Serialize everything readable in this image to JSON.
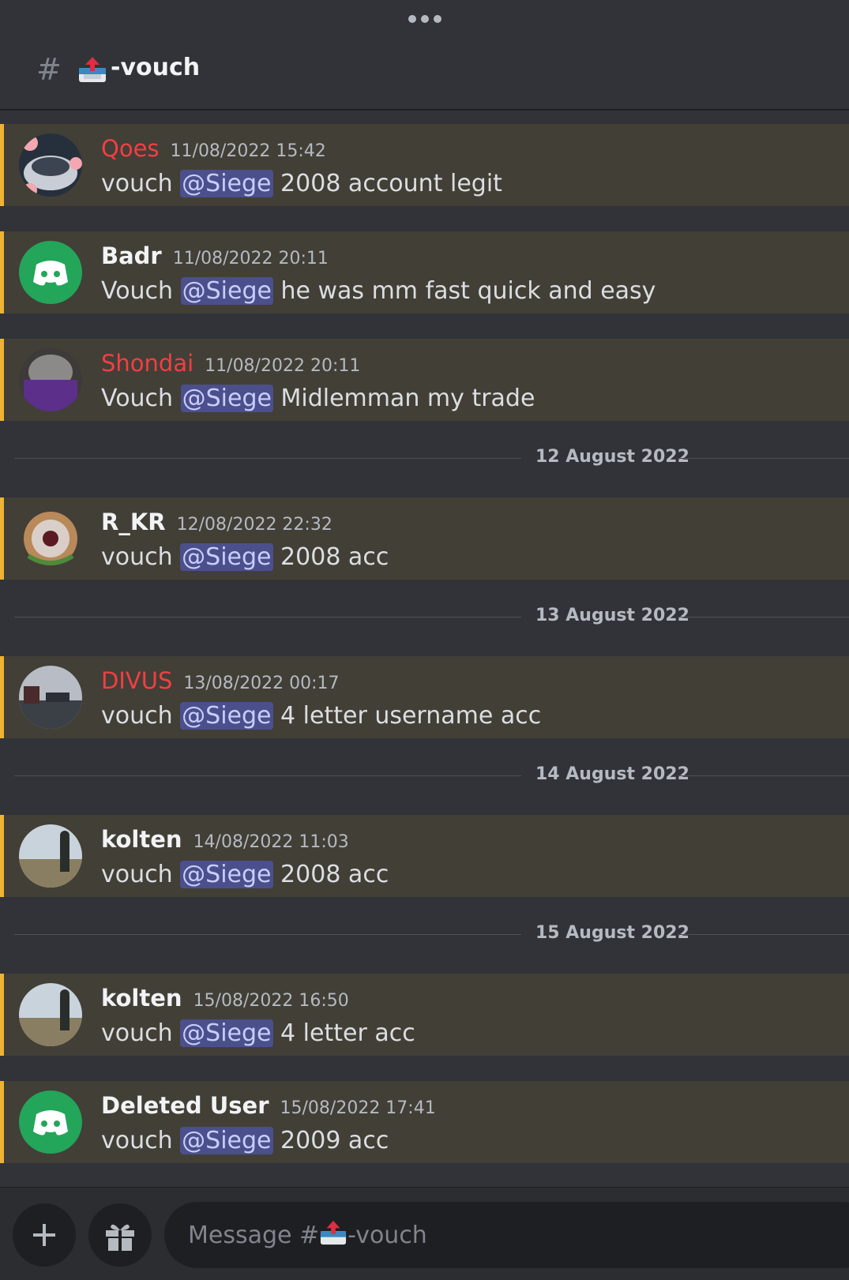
{
  "channel": {
    "hash": "#",
    "name": "-vouch",
    "icon": "outbox-tray-icon"
  },
  "messages": [
    {
      "author": "Qoes",
      "timestamp": "11/08/2022 15:42",
      "pre": "vouch ",
      "mention": "@Siege",
      "post": " 2008 account legit"
    },
    {
      "author": "Badr",
      "timestamp": "11/08/2022 20:11",
      "pre": "Vouch ",
      "mention": "@Siege",
      "post": " he was mm fast quick and easy"
    },
    {
      "author": "Shondai",
      "timestamp": "11/08/2022 20:11",
      "pre": "Vouch ",
      "mention": "@Siege",
      "post": " Midlemman my trade"
    },
    {
      "author": "R_KR",
      "timestamp": "12/08/2022 22:32",
      "pre": "vouch ",
      "mention": "@Siege",
      "post": " 2008 acc"
    },
    {
      "author": "DIVUS",
      "timestamp": "13/08/2022 00:17",
      "pre": "vouch ",
      "mention": "@Siege",
      "post": " 4 letter username acc"
    },
    {
      "author": "kolten",
      "timestamp": "14/08/2022 11:03",
      "pre": "vouch ",
      "mention": "@Siege",
      "post": " 2008 acc"
    },
    {
      "author": "kolten",
      "timestamp": "15/08/2022 16:50",
      "pre": "vouch ",
      "mention": "@Siege",
      "post": " 4 letter acc"
    },
    {
      "author": "Deleted User",
      "timestamp": "15/08/2022 17:41",
      "pre": "vouch ",
      "mention": "@Siege",
      "post": " 2009 acc"
    }
  ],
  "dividers": [
    "12 August 2022",
    "13 August 2022",
    "14 August 2022",
    "15 August 2022"
  ],
  "composer": {
    "placeholder_prefix": "Message #",
    "placeholder_suffix": "-vouch",
    "add_icon": "plus-icon",
    "gift_icon": "gift-icon"
  },
  "colors": {
    "highlight": "#f0b232",
    "mention_bg": "#4b4f8c",
    "red_name": "#f23f43",
    "discord_green": "#23a55a"
  }
}
